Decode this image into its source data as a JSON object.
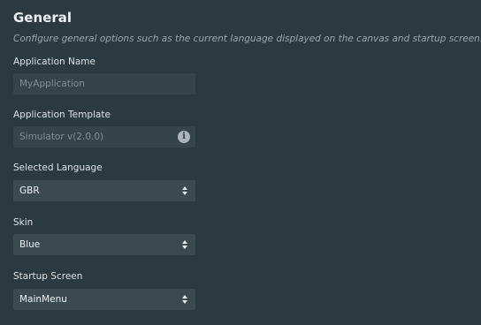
{
  "section": {
    "title": "General",
    "description": "Configure general options such as the current language displayed on the canvas and startup screen."
  },
  "fields": {
    "application_name": {
      "label": "Application Name",
      "value": "MyApplication"
    },
    "application_template": {
      "label": "Application Template",
      "value": "Simulator v(2.0.0)",
      "icon": "info-icon"
    },
    "selected_language": {
      "label": "Selected Language",
      "value": "GBR",
      "icon": "up-down-stepper-icon"
    },
    "skin": {
      "label": "Skin",
      "value": "Blue",
      "icon": "up-down-stepper-icon"
    },
    "startup_screen": {
      "label": "Startup Screen",
      "value": "MainMenu",
      "icon": "up-down-stepper-icon"
    }
  },
  "colors": {
    "background": "#2b3940",
    "field_readonly": "#344448",
    "field_select": "#3a4a4f",
    "description_text": "#98a9af"
  }
}
